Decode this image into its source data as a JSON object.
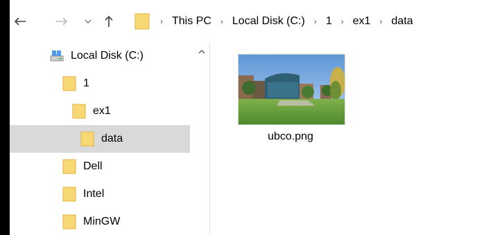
{
  "address_bar": {
    "path": [
      "This PC",
      "Local Disk (C:)",
      "1",
      "ex1",
      "data"
    ]
  },
  "nav_pane": {
    "items": [
      {
        "label": "Local Disk (C:)",
        "icon": "drive-icon",
        "depth": 0,
        "selected": false
      },
      {
        "label": "1",
        "icon": "folder-icon",
        "depth": 1,
        "selected": false
      },
      {
        "label": "ex1",
        "icon": "folder-icon",
        "depth": 2,
        "selected": false
      },
      {
        "label": "data",
        "icon": "folder-icon",
        "depth": 3,
        "selected": true
      },
      {
        "label": "Dell",
        "icon": "folder-icon",
        "depth": 1,
        "selected": false
      },
      {
        "label": "Intel",
        "icon": "folder-icon",
        "depth": 1,
        "selected": false
      },
      {
        "label": "MinGW",
        "icon": "folder-icon",
        "depth": 1,
        "selected": false
      }
    ]
  },
  "content": {
    "files": [
      {
        "name": "ubco.png",
        "type": "image-thumbnail"
      }
    ]
  },
  "colors": {
    "selected_bg": "#d9d9d9",
    "folder_yellow": "#f8d775",
    "folder_dark": "#e0b23c"
  }
}
